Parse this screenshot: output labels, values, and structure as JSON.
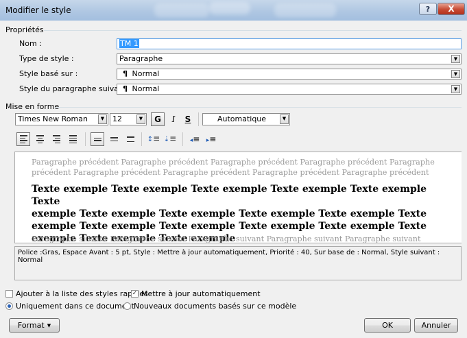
{
  "window": {
    "title": "Modifier le style",
    "help_label": "?",
    "close_label": "X"
  },
  "properties": {
    "section_label": "Propriétés",
    "name_label": "Nom :",
    "name_value": "TM 1",
    "type_label": "Type de style :",
    "type_value": "Paragraphe",
    "based_on_label": "Style basé sur :",
    "based_on_value": "Normal",
    "next_label": "Style du paragraphe suivant :",
    "next_value": "Normal",
    "para_mark": "¶"
  },
  "formatting": {
    "section_label": "Mise en forme",
    "font_value": "Times New Roman",
    "size_value": "12",
    "bold_label": "G",
    "italic_label": "I",
    "underline_label": "S",
    "color_value": "Automatique"
  },
  "preview": {
    "preceding_line1": "Paragraphe précédent Paragraphe précédent Paragraphe précédent Paragraphe précédent Paragraphe",
    "preceding_line2": "précédent Paragraphe précédent Paragraphe précédent Paragraphe précédent Paragraphe précédent",
    "sample_line1": "Texte exemple Texte exemple Texte exemple Texte exemple Texte exemple Texte",
    "sample_line2": "exemple Texte exemple Texte exemple Texte exemple Texte exemple Texte",
    "sample_line3": "exemple Texte exemple Texte exemple Texte exemple Texte exemple Texte",
    "sample_line4": "exemple Texte exemple Texte exemple",
    "following_line": "Paragraphe suivant Paragraphe suivant Paragraphe suivant Paragraphe suivant Paragraphe suivant"
  },
  "description": "Police :Gras, Espace Avant : 5 pt, Style : Mettre à jour automatiquement, Priorité : 40, Sur base de : Normal, Style suivant : Normal",
  "options": {
    "add_quick_styles": "Ajouter à la liste des styles rapides",
    "add_quick_styles_checked": false,
    "auto_update": "Mettre à jour automatiquement",
    "auto_update_checked": true,
    "only_this_doc": "Uniquement dans ce document",
    "new_docs": "Nouveaux documents basés sur ce modèle",
    "selected_scope": "only_this_doc"
  },
  "buttons": {
    "format": "Format",
    "ok": "OK",
    "cancel": "Annuler"
  },
  "icons": [
    "help-icon",
    "close-icon",
    "dropdown-arrow-icon",
    "paragraph-mark-icon",
    "align-left-icon",
    "align-center-icon",
    "align-right-icon",
    "justify-icon",
    "single-spacing-icon",
    "one-half-spacing-icon",
    "double-spacing-icon",
    "space-before-increase-icon",
    "space-before-decrease-icon",
    "indent-decrease-icon",
    "indent-increase-icon"
  ]
}
